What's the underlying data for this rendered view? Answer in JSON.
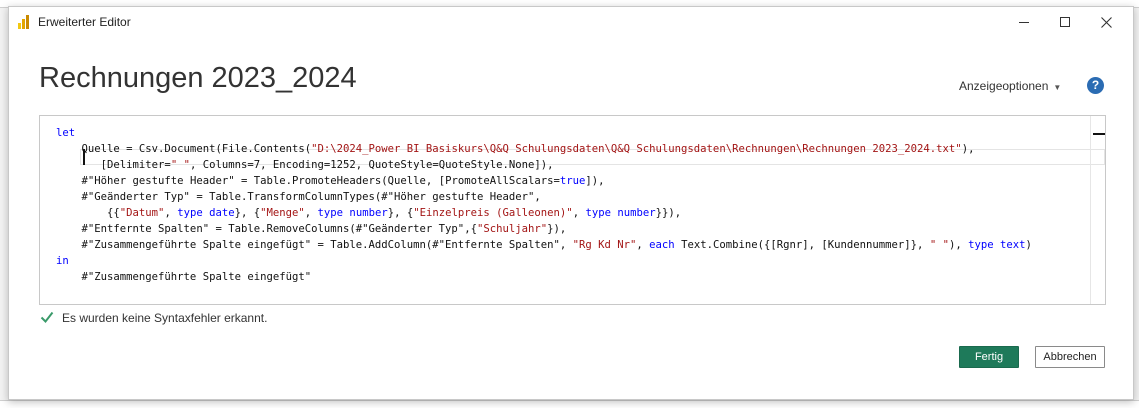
{
  "window": {
    "title": "Erweiterter Editor",
    "app_icon": "power-bi-icon"
  },
  "header": {
    "query_name": "Rechnungen 2023_2024",
    "view_options_label": "Anzeigeoptionen",
    "help_icon": "question-circle-icon"
  },
  "code_lines": [
    [
      {
        "t": "let",
        "k": "kw"
      }
    ],
    [
      {
        "t": "    Quelle = Csv.Document(File.Contents(",
        "k": ""
      },
      {
        "t": "\"D:\\2024_Power BI Basiskurs\\Q&Q Schulungsdaten\\Q&Q Schulungsdaten\\Rechnungen\\Rechnungen 2023_2024.txt\"",
        "k": "str"
      },
      {
        "t": "),",
        "k": ""
      }
    ],
    [
      {
        "t": "       [Delimiter=",
        "k": ""
      },
      {
        "t": "\"\t\"",
        "k": "str"
      },
      {
        "t": ", Columns=7, Encoding=1252, QuoteStyle=QuoteStyle.None]),",
        "k": ""
      }
    ],
    [
      {
        "t": "    #",
        "k": ""
      },
      {
        "t": "\"Höher gestufte Header\"",
        "k": ""
      },
      {
        "t": " = Table.PromoteHeaders(Quelle, [PromoteAllScalars=",
        "k": ""
      },
      {
        "t": "true",
        "k": "kw"
      },
      {
        "t": "]),",
        "k": ""
      }
    ],
    [
      {
        "t": "    #\"Geänderter Typ\" = Table.TransformColumnTypes(#\"Höher gestufte Header\",",
        "k": ""
      }
    ],
    [
      {
        "t": "        {{",
        "k": ""
      },
      {
        "t": "\"Datum\"",
        "k": "str"
      },
      {
        "t": ", ",
        "k": ""
      },
      {
        "t": "type date",
        "k": "kw"
      },
      {
        "t": "}, {",
        "k": ""
      },
      {
        "t": "\"Menge\"",
        "k": "str"
      },
      {
        "t": ", ",
        "k": ""
      },
      {
        "t": "type number",
        "k": "kw"
      },
      {
        "t": "}, {",
        "k": ""
      },
      {
        "t": "\"Einzelpreis (Galleonen)\"",
        "k": "str"
      },
      {
        "t": ", ",
        "k": ""
      },
      {
        "t": "type number",
        "k": "kw"
      },
      {
        "t": "}}),",
        "k": ""
      }
    ],
    [
      {
        "t": "    #\"Entfernte Spalten\" = Table.RemoveColumns(#\"Geänderter Typ\",{",
        "k": ""
      },
      {
        "t": "\"Schuljahr\"",
        "k": "str"
      },
      {
        "t": "}),",
        "k": ""
      }
    ],
    [
      {
        "t": "    #\"Zusammengeführte Spalte eingefügt\" = Table.AddColumn(#\"Entfernte Spalten\", ",
        "k": ""
      },
      {
        "t": "\"Rg Kd Nr\"",
        "k": "str"
      },
      {
        "t": ", ",
        "k": ""
      },
      {
        "t": "each",
        "k": "kw"
      },
      {
        "t": " Text.Combine({[Rgnr], [Kundennummer]}, ",
        "k": ""
      },
      {
        "t": "\" \"",
        "k": "str"
      },
      {
        "t": "), ",
        "k": ""
      },
      {
        "t": "type text",
        "k": "kw"
      },
      {
        "t": ")",
        "k": ""
      }
    ],
    [
      {
        "t": "in",
        "k": "kw"
      }
    ],
    [
      {
        "t": "    #\"Zusammengeführte Spalte eingefügt\"",
        "k": ""
      }
    ]
  ],
  "status": {
    "icon": "checkmark-icon",
    "text": "Es wurden keine Syntaxfehler erkannt."
  },
  "buttons": {
    "ok_label": "Fertig",
    "cancel_label": "Abbrechen"
  },
  "colors": {
    "keyword": "#0000ff",
    "string": "#a31515",
    "ok_button": "#1e7a5a",
    "help_icon": "#2b6cb3",
    "check": "#3a9a6a"
  }
}
